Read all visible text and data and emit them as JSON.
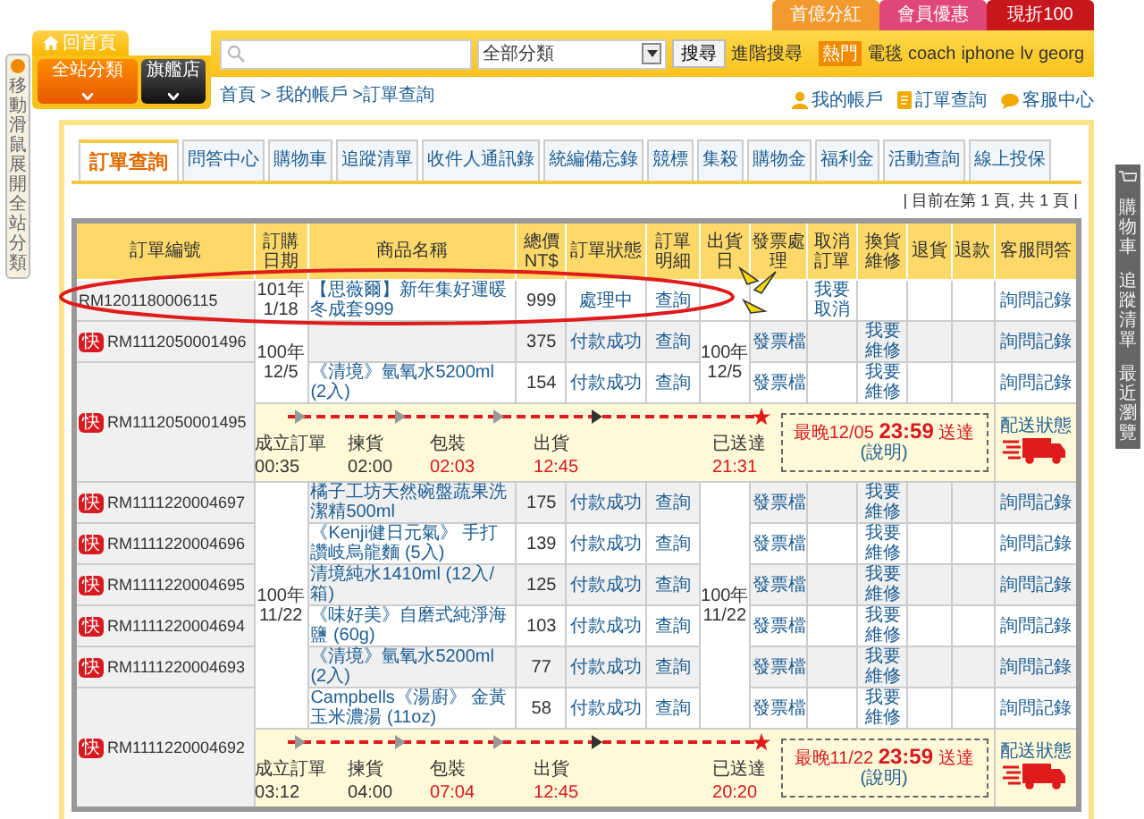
{
  "promo_tabs": [
    {
      "label": "首億分紅",
      "color": "#f29a2e"
    },
    {
      "label": "會員優惠",
      "color": "#e0457b"
    },
    {
      "label": "現折100",
      "color": "#c8161d"
    }
  ],
  "home_tab": "回首頁",
  "category_buttons": [
    {
      "label": "全站分類",
      "kind": "primary"
    },
    {
      "label": "旗艦店",
      "kind": "dark"
    }
  ],
  "search": {
    "category": "全部分類",
    "button": "搜尋",
    "advanced": "進階搜尋",
    "hot_badge": "熱門",
    "hot_keywords": [
      "電毯",
      "coach",
      "iphone",
      "lv",
      "georg"
    ]
  },
  "breadcrumb": "首頁 > 我的帳戶 >訂單查詢",
  "account_links": [
    "我的帳戶",
    "訂單查詢",
    "客服中心"
  ],
  "side_tab": "移動滑鼠展開全站分類",
  "right_bar": [
    "購物車",
    "追蹤清單",
    "最近瀏覽"
  ],
  "tabs": [
    {
      "label": "訂單查詢",
      "selected": true
    },
    {
      "label": "問答中心",
      "selected": false
    },
    {
      "label": "購物車",
      "selected": false
    },
    {
      "label": "追蹤清單",
      "selected": false
    },
    {
      "label": "收件人通訊錄",
      "selected": false
    },
    {
      "label": "統編備忘錄",
      "selected": false
    },
    {
      "label": "競標",
      "selected": false
    },
    {
      "label": "集殺",
      "selected": false
    },
    {
      "label": "購物金",
      "selected": false
    },
    {
      "label": "福利金",
      "selected": false
    },
    {
      "label": "活動查詢",
      "selected": false
    },
    {
      "label": "線上投保",
      "selected": false
    }
  ],
  "pager": "| 目前在第 1 頁, 共 1 頁 |",
  "table": {
    "columns": [
      "訂單編號",
      "訂購日期",
      "商品名稱",
      "總價NT$",
      "訂單狀態",
      "訂單明細",
      "出貨日",
      "發票處理",
      "取消訂單",
      "換貨維修",
      "退貨",
      "退款",
      "客服問答"
    ],
    "groups": [
      {
        "order_date": "101年\n1/18",
        "rows": [
          {
            "order": "RM1201180006115",
            "circled": true,
            "product": "【思薇爾】新年集好運暖冬成套999",
            "price": "999",
            "status": "處理中",
            "detail": "查詢",
            "cancel": "我要取消",
            "ask": "詢問",
            "log": "記錄"
          }
        ]
      },
      {
        "order_date": "100年\n12/5",
        "ship_date": "100年\n12/5",
        "rows": [
          {
            "order": "RM1112050001496",
            "badge": "快",
            "price": "375",
            "status": "付款成功",
            "detail": "查詢",
            "invoice": "發票檔",
            "exchange": "我要維修",
            "ask": "詢問",
            "log": "記錄"
          },
          {
            "order": "RM1112050001495",
            "badge": "快",
            "product": "《清境》氫氧水5200ml (2入)",
            "price": "154",
            "status": "付款成功",
            "detail": "查詢",
            "invoice": "發票檔",
            "exchange": "我要維修",
            "ask": "詢問",
            "log": "記錄"
          }
        ],
        "delivery": {
          "steps": [
            {
              "label": "成立訂單",
              "time": "00:35",
              "late": false
            },
            {
              "label": "揀貨",
              "time": "02:00",
              "late": false
            },
            {
              "label": "包裝",
              "time": "02:03",
              "late": true
            },
            {
              "label": "出貨",
              "time": "12:45",
              "late": true
            },
            {
              "label": "已送達",
              "time": "21:31",
              "late": true
            }
          ],
          "deadline": "最晚12/05 **23:59** 送達",
          "note_link": "(說明)",
          "status_link": "配送狀態"
        }
      },
      {
        "order_date": "100年\n11/22",
        "ship_date": "100年\n11/22",
        "rows": [
          {
            "order": "RM1111220004697",
            "badge": "快",
            "product": "橘子工坊天然碗盤蔬果洗潔精500ml",
            "price": "175",
            "status": "付款成功",
            "detail": "查詢",
            "invoice": "發票檔",
            "exchange": "我要維修",
            "ask": "詢問",
            "log": "記錄"
          },
          {
            "order": "RM1111220004696",
            "badge": "快",
            "product": "《Kenji健日元氣》 手打讚岐烏龍麵 (5入)",
            "price": "139",
            "status": "付款成功",
            "detail": "查詢",
            "invoice": "發票檔",
            "exchange": "我要維修",
            "ask": "詢問",
            "log": "記錄"
          },
          {
            "order": "RM1111220004695",
            "badge": "快",
            "product": "清境純水1410ml (12入/箱)",
            "price": "125",
            "status": "付款成功",
            "detail": "查詢",
            "invoice": "發票檔",
            "exchange": "我要維修",
            "ask": "詢問",
            "log": "記錄"
          },
          {
            "order": "RM1111220004694",
            "badge": "快",
            "product": "《味好美》自磨式純淨海鹽 (60g)",
            "price": "103",
            "status": "付款成功",
            "detail": "查詢",
            "invoice": "發票檔",
            "exchange": "我要維修",
            "ask": "詢問",
            "log": "記錄"
          },
          {
            "order": "RM1111220004693",
            "badge": "快",
            "product": "《清境》氫氧水5200ml (2入)",
            "price": "77",
            "status": "付款成功",
            "detail": "查詢",
            "invoice": "發票檔",
            "exchange": "我要維修",
            "ask": "詢問",
            "log": "記錄"
          },
          {
            "order": "RM1111220004692",
            "badge": "快",
            "product": "Campbells《湯廚》 金黃玉米濃湯 (11oz)",
            "price": "58",
            "status": "付款成功",
            "detail": "查詢",
            "invoice": "發票檔",
            "exchange": "我要維修",
            "ask": "詢問",
            "log": "記錄"
          }
        ],
        "delivery": {
          "steps": [
            {
              "label": "成立訂單",
              "time": "03:12",
              "late": false
            },
            {
              "label": "揀貨",
              "time": "04:00",
              "late": false
            },
            {
              "label": "包裝",
              "time": "07:04",
              "late": true
            },
            {
              "label": "出貨",
              "time": "12:45",
              "late": true
            },
            {
              "label": "已送達",
              "time": "20:20",
              "late": true
            }
          ],
          "deadline": "最晚11/22 **23:59** 送達",
          "note_link": "(說明)",
          "status_link": "配送狀態"
        }
      }
    ]
  }
}
